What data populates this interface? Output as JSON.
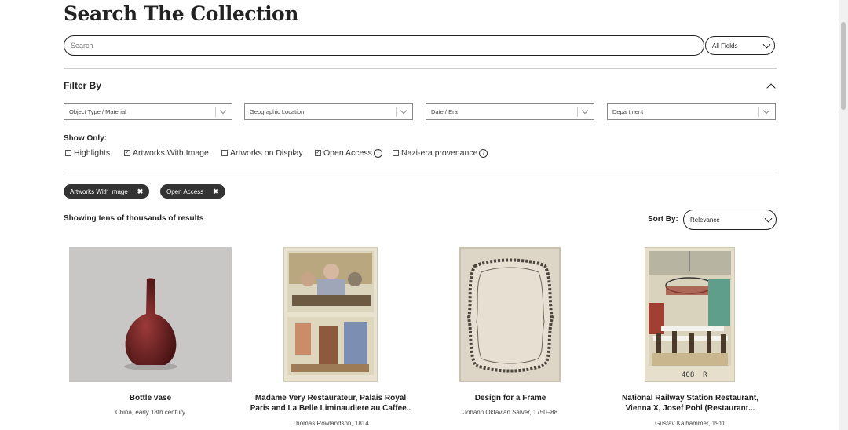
{
  "page": {
    "title": "Search The Collection",
    "search_placeholder": "Search",
    "fields_select": "All Fields"
  },
  "filters": {
    "heading": "Filter By",
    "dropdowns": [
      "Object Type / Material",
      "Geographic Location",
      "Date / Era",
      "Department"
    ],
    "show_only_label": "Show Only:",
    "checkboxes": [
      {
        "label": "Highlights",
        "checked": false
      },
      {
        "label": "Artworks With Image",
        "checked": true
      },
      {
        "label": "Artworks on Display",
        "checked": false
      },
      {
        "label": "Open Access",
        "checked": true,
        "info": true
      },
      {
        "label": "Nazi-era provenance",
        "checked": false,
        "info": true
      }
    ],
    "active_pills": [
      "Artworks With Image",
      "Open Access"
    ]
  },
  "results": {
    "summary": "Showing tens of thousands of results",
    "sort_label": "Sort By:",
    "sort_value": "Relevance",
    "cards": [
      {
        "title": "Bottle vase",
        "sub": "China, early 18th century",
        "artist": ""
      },
      {
        "title": "Madame Very Restaurateur, Palais Royal\nParis and La Belle Liminaudiere au Caffee..",
        "sub": "",
        "artist": "Thomas Rowlandson, 1814"
      },
      {
        "title": "Design for a Frame",
        "sub": "",
        "artist": "Johann Oktavian Salver, 1750–88"
      },
      {
        "title": "National Railway Station Restaurant,\nVienna X, Josef Pohl (Restaurant...",
        "sub": "",
        "artist": "Gustav Kalhammer, 1911"
      }
    ]
  },
  "colors": {
    "pill_bg": "#333333",
    "text": "#222222"
  }
}
